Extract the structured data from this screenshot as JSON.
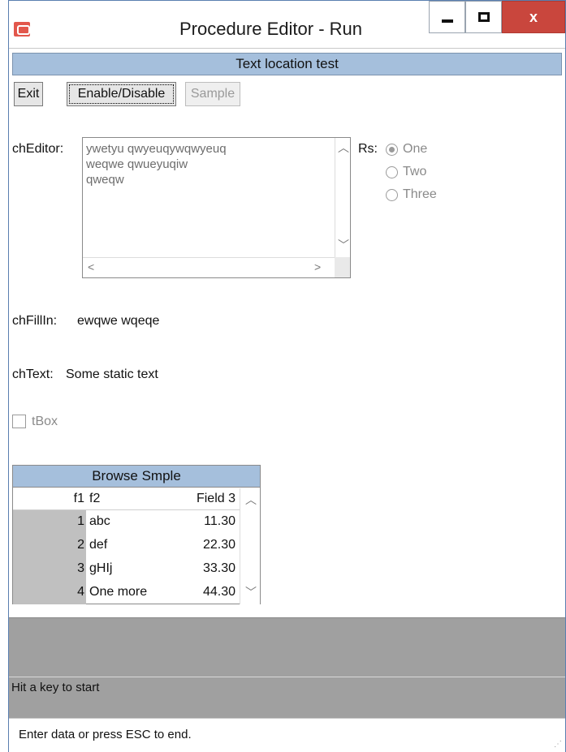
{
  "window": {
    "title": "Procedure Editor - Run",
    "min_icon": "minimize-icon",
    "max_icon": "maximize-icon",
    "close_label": "x"
  },
  "frame": {
    "title": "Text location test"
  },
  "toolbar": {
    "exit_label": "Exit",
    "enable_label": "Enable/Disable",
    "sample_label": "Sample"
  },
  "editor": {
    "label": "chEditor:",
    "text": "ywetyu qwyeuqywqwyeuq\nweqwe qwueyuqiw\nqweqw"
  },
  "radio": {
    "label": "Rs:",
    "options": [
      {
        "label": "One",
        "selected": true
      },
      {
        "label": "Two",
        "selected": false
      },
      {
        "label": "Three",
        "selected": false
      }
    ]
  },
  "fillin": {
    "label": "chFillIn:",
    "value": "ewqwe wqeqe"
  },
  "text_field": {
    "label": "chText:",
    "value": "Some static text"
  },
  "tbox": {
    "label": "tBox",
    "checked": false
  },
  "browse": {
    "title": "Browse Smple",
    "columns": [
      "f1",
      "f2",
      "Field 3"
    ],
    "rows": [
      [
        "1",
        "abc",
        "11.30"
      ],
      [
        "2",
        "def",
        "22.30"
      ],
      [
        "3",
        "gHIj",
        "33.30"
      ],
      [
        "4",
        "One more",
        "44.30"
      ]
    ]
  },
  "status": {
    "message": "Hit a key to start",
    "hint": "Enter data or press ESC to end."
  },
  "colors": {
    "frame_title_bg": "#a5bfdc",
    "close_button": "#c9463d",
    "gray_area": "#a0a0a0"
  }
}
